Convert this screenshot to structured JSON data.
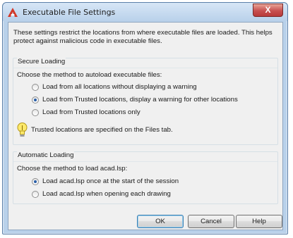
{
  "window": {
    "title": "Executable File Settings",
    "close_glyph": "X"
  },
  "intro": "These settings restrict the locations from where executable files are loaded.  This helps protect against malicious code in executable files.",
  "secure_loading": {
    "title": "Secure Loading",
    "prompt": "Choose the method to autoload executable files:",
    "options": [
      {
        "label": "Load from all locations without displaying a warning",
        "checked": false
      },
      {
        "label": "Load from Trusted locations, display a warning for other locations",
        "checked": true
      },
      {
        "label": "Load from Trusted locations only",
        "checked": false
      }
    ],
    "info": "Trusted locations are specified on the Files tab."
  },
  "automatic_loading": {
    "title": "Automatic Loading",
    "prompt": "Choose the method to load acad.lsp:",
    "options": [
      {
        "label": "Load acad.lsp once at the start of the session",
        "checked": true
      },
      {
        "label": "Load acad.lsp when opening each drawing",
        "checked": false
      }
    ]
  },
  "buttons": {
    "ok": "OK",
    "cancel": "Cancel",
    "help": "Help"
  },
  "colors": {
    "app_icon": "#d23a2a",
    "radio_selected": "#2a5fa8",
    "close_button": "#c75050"
  },
  "icons": {
    "app": "autocad-a-icon",
    "info": "lightbulb-icon",
    "radio": "radio-icon"
  }
}
